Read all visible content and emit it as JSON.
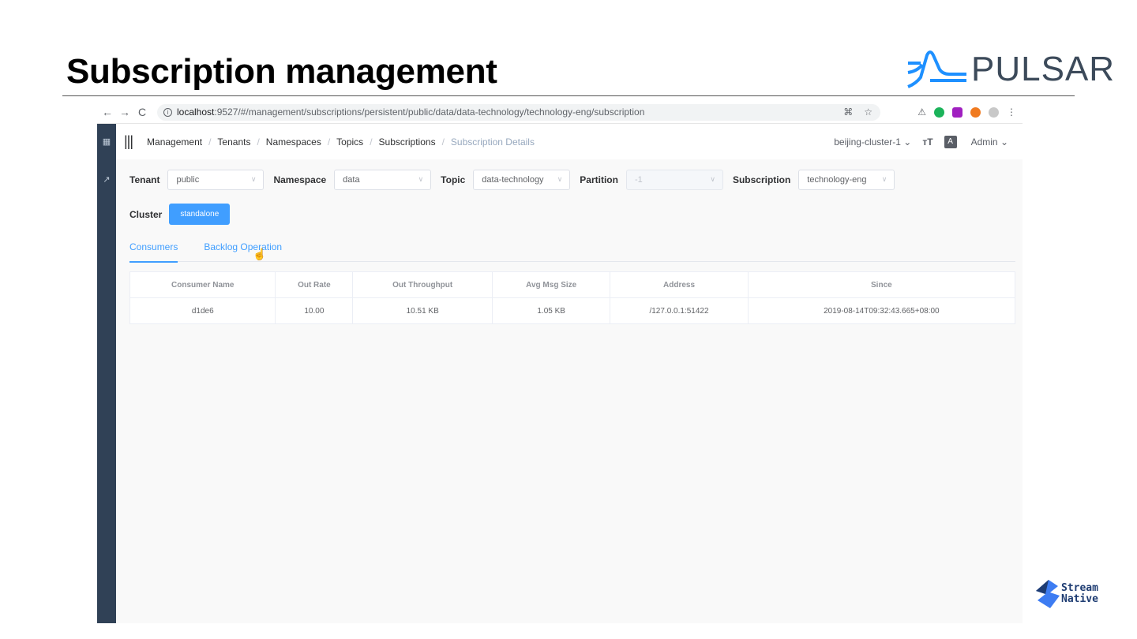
{
  "slide": {
    "title": "Subscription management",
    "logo_text": "PULSAR",
    "footer_logo_line1": "Stream",
    "footer_logo_line2": "Native"
  },
  "browser": {
    "back": "←",
    "forward": "→",
    "reload": "C",
    "url_host": "localhost",
    "url_path": ":9527/#/management/subscriptions/persistent/public/data/data-technology/technology-eng/subscription",
    "menu": "⋮"
  },
  "topbar": {
    "breadcrumb": [
      "Management",
      "Tenants",
      "Namespaces",
      "Topics",
      "Subscriptions",
      "Subscription Details"
    ],
    "cluster": "beijing-cluster-1",
    "font_icon": "тT",
    "lang_icon": "A",
    "user": "Admin"
  },
  "filters": {
    "tenant_label": "Tenant",
    "tenant_value": "public",
    "namespace_label": "Namespace",
    "namespace_value": "data",
    "topic_label": "Topic",
    "topic_value": "data-technology",
    "partition_label": "Partition",
    "partition_value": "-1",
    "subscription_label": "Subscription",
    "subscription_value": "technology-eng",
    "cluster_label": "Cluster",
    "cluster_button": "standalone"
  },
  "tabs": [
    "Consumers",
    "Backlog Operation"
  ],
  "table": {
    "headers": [
      "Consumer Name",
      "Out Rate",
      "Out Throughput",
      "Avg Msg Size",
      "Address",
      "Since"
    ],
    "rows": [
      [
        "d1de6",
        "10.00",
        "10.51 KB",
        "1.05 KB",
        "/127.0.0.1:51422",
        "2019-08-14T09:32:43.665+08:00"
      ]
    ]
  },
  "colors": {
    "primary": "#409eff",
    "sidebar": "#304156",
    "pulsar_blue": "#1e90ff",
    "pulsar_text": "#3c4a5a"
  }
}
